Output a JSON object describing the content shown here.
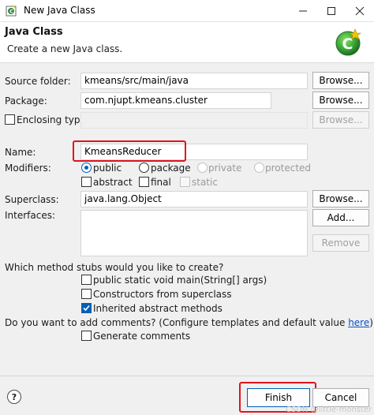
{
  "window": {
    "title": "New Java Class"
  },
  "header": {
    "title": "Java Class",
    "description": "Create a new Java class."
  },
  "source_folder": {
    "label": "Source folder:",
    "value": "kmeans/src/main/java",
    "browse_label": "Browse..."
  },
  "package": {
    "label": "Package:",
    "value": "com.njupt.kmeans.cluster",
    "browse_label": "Browse..."
  },
  "enclosing_type": {
    "label": "Enclosing type:",
    "checked": false,
    "value": "",
    "browse_label": "Browse..."
  },
  "name": {
    "label": "Name:",
    "value": "KmeansReducer"
  },
  "modifiers": {
    "label": "Modifiers:",
    "access": [
      {
        "label": "public",
        "selected": true,
        "enabled": true
      },
      {
        "label": "package",
        "selected": false,
        "enabled": true
      },
      {
        "label": "private",
        "selected": false,
        "enabled": false
      },
      {
        "label": "protected",
        "selected": false,
        "enabled": false
      }
    ],
    "flags": [
      {
        "label": "abstract",
        "checked": false,
        "enabled": true
      },
      {
        "label": "final",
        "checked": false,
        "enabled": true
      },
      {
        "label": "static",
        "checked": false,
        "enabled": false
      }
    ]
  },
  "superclass": {
    "label": "Superclass:",
    "value": "java.lang.Object",
    "browse_label": "Browse..."
  },
  "interfaces": {
    "label": "Interfaces:",
    "add_label": "Add...",
    "remove_label": "Remove"
  },
  "stubs": {
    "question": "Which method stubs would you like to create?",
    "options": [
      {
        "label": "public static void main(String[] args)",
        "checked": false
      },
      {
        "label": "Constructors from superclass",
        "checked": false
      },
      {
        "label": "Inherited abstract methods",
        "checked": true
      }
    ]
  },
  "comments": {
    "question": "Do you want to add comments? (Configure templates and default value ",
    "link_text": "here",
    "question_end": ")",
    "option_label": "Generate comments",
    "option_checked": false
  },
  "footer": {
    "help_glyph": "?",
    "finish_label": "Finish",
    "cancel_label": "Cancel",
    "watermark": "CSDN @little-monster"
  },
  "colors": {
    "highlight": "#e0141e",
    "accent": "#005fb8",
    "link": "#0a50c8"
  },
  "icons": {
    "app": "java-class-icon",
    "banner": "new-class-wizard-icon",
    "minimize": "minimize-icon",
    "maximize": "maximize-icon",
    "close": "close-icon",
    "help": "help-icon"
  }
}
